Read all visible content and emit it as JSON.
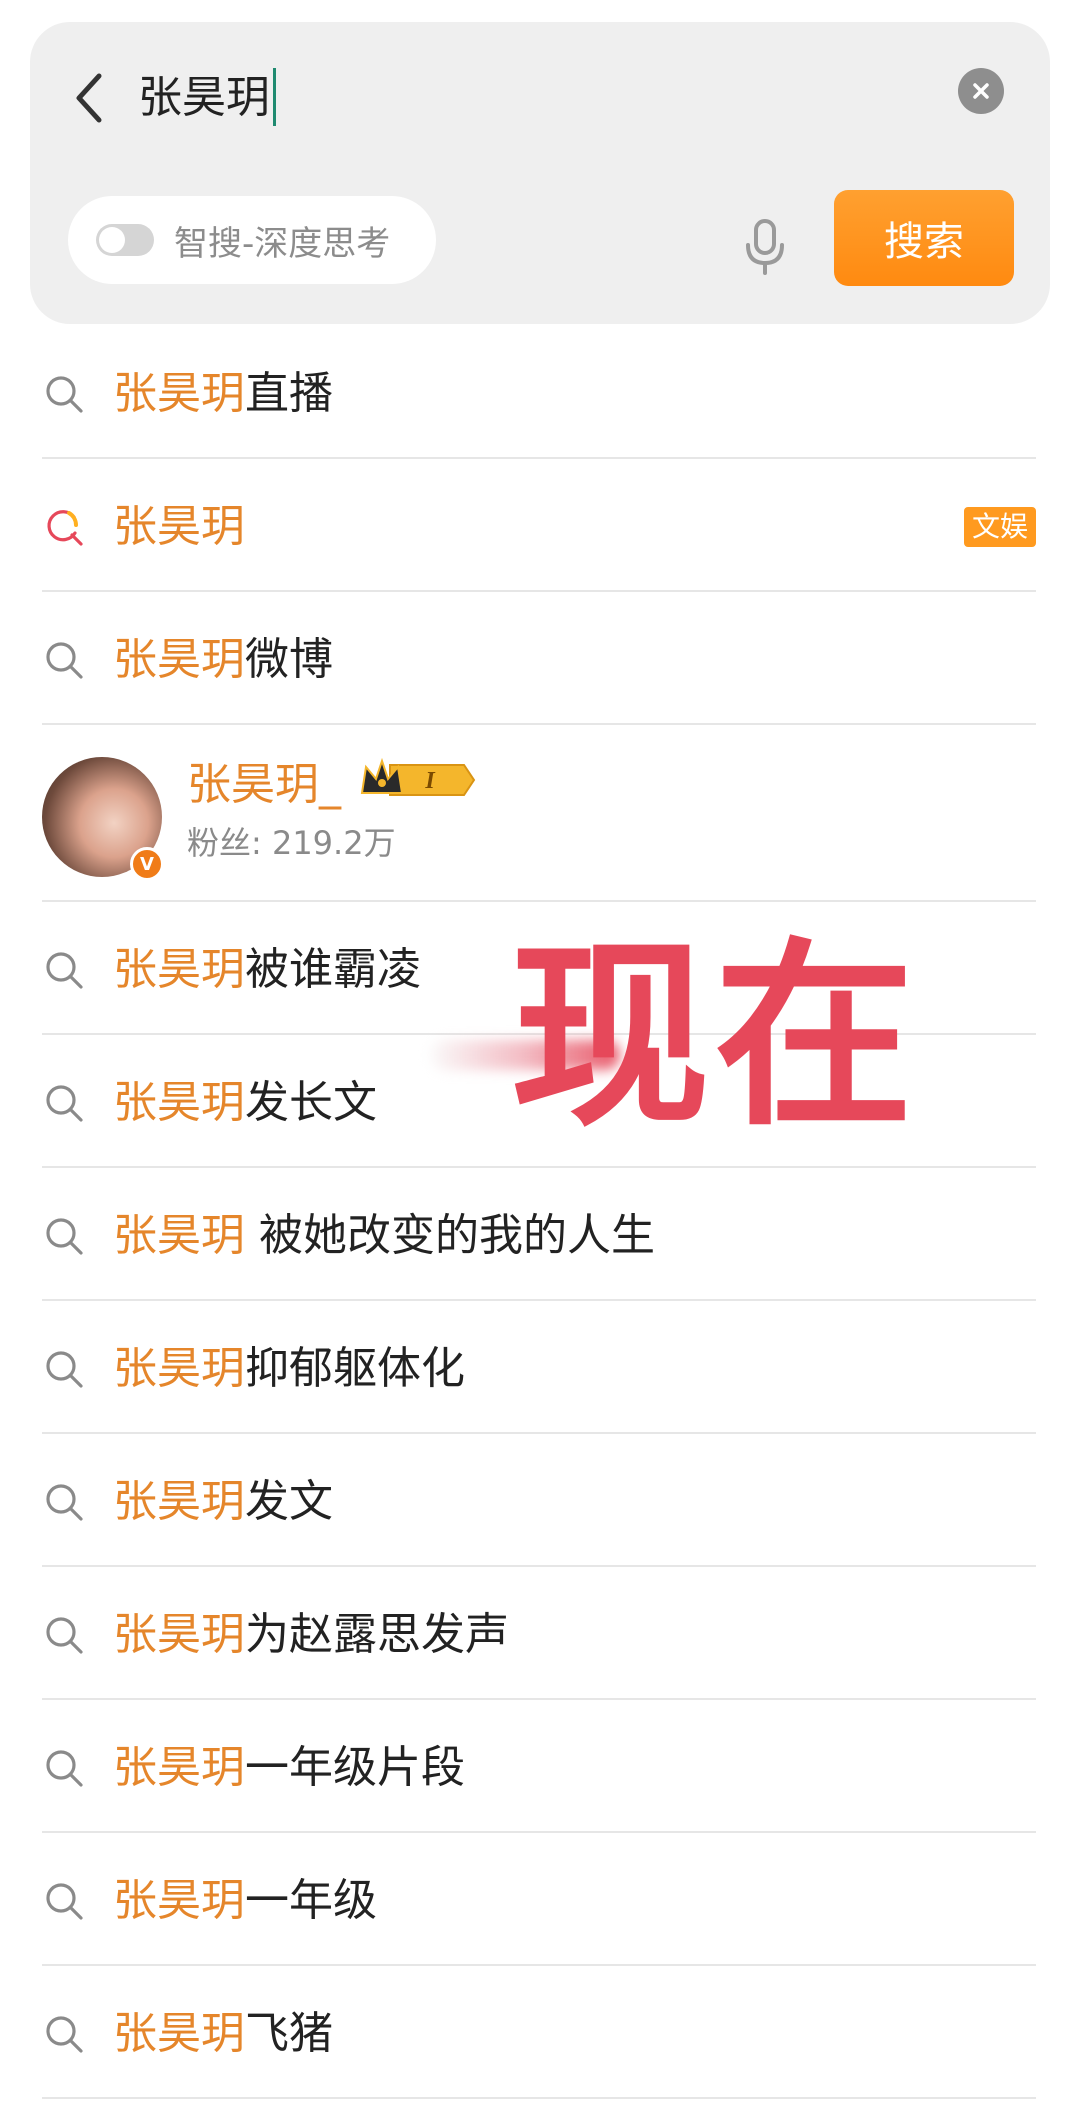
{
  "search": {
    "query": "张昊玥",
    "deep_think_label": "智搜-深度思考",
    "search_button_label": "搜索"
  },
  "colors": {
    "highlight": "#e5862b",
    "accent_button": "#ff8a10",
    "overlay_text": "#e6485a",
    "hot_tag": "#ff9a1f"
  },
  "suggestions": [
    {
      "type": "query",
      "icon": "search-icon",
      "highlight": "张昊玥",
      "rest": "直播"
    },
    {
      "type": "query",
      "icon": "hot-search-icon",
      "highlight": "张昊玥",
      "rest": "",
      "tag": "文娱"
    },
    {
      "type": "query",
      "icon": "search-icon",
      "highlight": "张昊玥",
      "rest": "微博"
    },
    {
      "type": "user",
      "icon": "avatar",
      "name": "张昊玥_",
      "fans": "粉丝: 219.2万",
      "badge": "I",
      "verified": "V"
    },
    {
      "type": "query",
      "icon": "search-icon",
      "highlight": "张昊玥",
      "rest": "被谁霸凌"
    },
    {
      "type": "query",
      "icon": "search-icon",
      "highlight": "张昊玥",
      "rest": "发长文"
    },
    {
      "type": "query",
      "icon": "search-icon",
      "highlight": "张昊玥",
      "rest": " 被她改变的我的人生"
    },
    {
      "type": "query",
      "icon": "search-icon",
      "highlight": "张昊玥",
      "rest": "抑郁躯体化"
    },
    {
      "type": "query",
      "icon": "search-icon",
      "highlight": "张昊玥",
      "rest": "发文"
    },
    {
      "type": "query",
      "icon": "search-icon",
      "highlight": "张昊玥",
      "rest": "为赵露思发声"
    },
    {
      "type": "query",
      "icon": "search-icon",
      "highlight": "张昊玥",
      "rest": "一年级片段"
    },
    {
      "type": "query",
      "icon": "search-icon",
      "highlight": "张昊玥",
      "rest": "一年级"
    },
    {
      "type": "query",
      "icon": "search-icon",
      "highlight": "张昊玥",
      "rest": "飞猪"
    }
  ],
  "overlay": {
    "text": "现在"
  }
}
